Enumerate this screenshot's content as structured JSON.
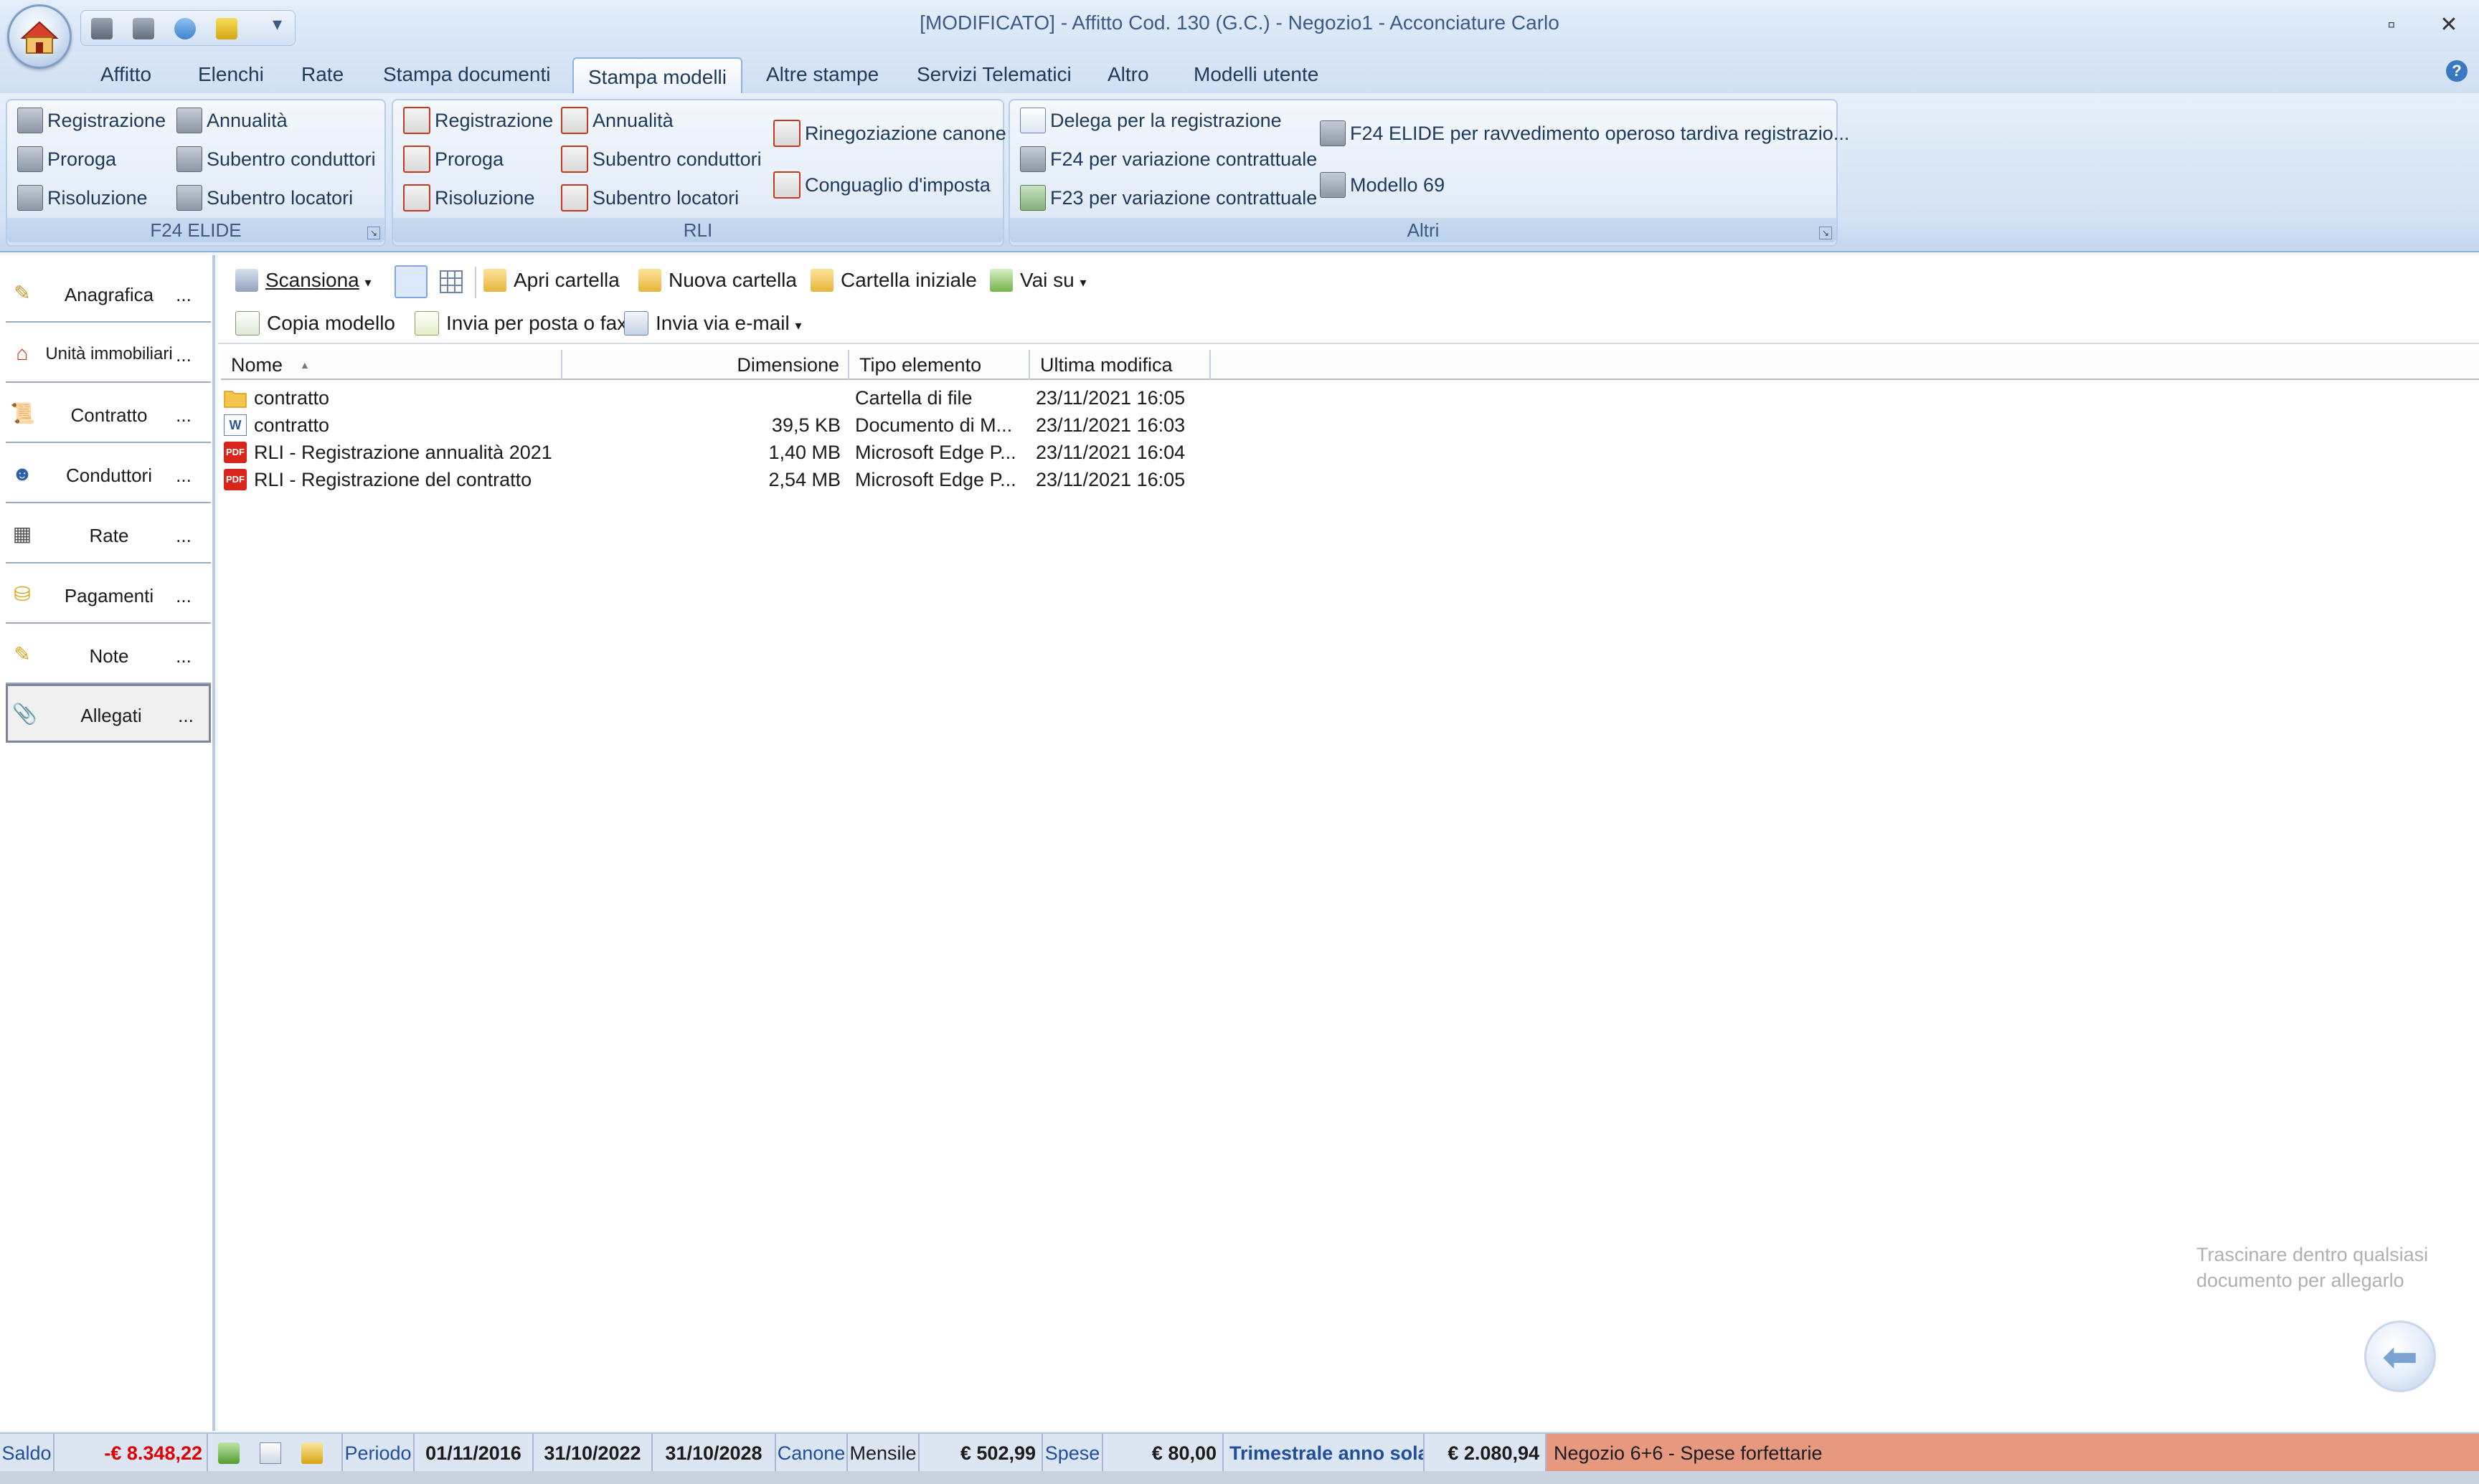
{
  "window": {
    "title": "[MODIFICATO] - Affitto Cod. 130 (G.C.) - Negozio1 - Acconciature Carlo",
    "qat_more": "▾",
    "restore_glyph": "▫",
    "close_glyph": "✕",
    "help_glyph": "?"
  },
  "tabs": [
    "Affitto",
    "Elenchi",
    "Rate",
    "Stampa documenti",
    "Stampa modelli",
    "Altre stampe",
    "Servizi Telematici",
    "Altro",
    "Modelli utente"
  ],
  "ribbon": {
    "f24": {
      "title": "F24 ELIDE",
      "items": [
        "Registrazione",
        "Proroga",
        "Risoluzione",
        "Annualità",
        "Subentro conduttori",
        "Subentro locatori"
      ]
    },
    "rli": {
      "title": "RLI",
      "items": [
        "Registrazione",
        "Proroga",
        "Risoluzione",
        "Annualità",
        "Subentro conduttori",
        "Subentro locatori",
        "Rinegoziazione canone",
        "Conguaglio d'imposta"
      ]
    },
    "altri": {
      "title": "Altri",
      "items": [
        "Delega per la registrazione",
        "F24 per variazione contrattuale",
        "F23 per variazione contrattuale",
        "F24 ELIDE per ravvedimento operoso tardiva registrazio...",
        "Modello 69"
      ]
    }
  },
  "nav": {
    "dots": "...",
    "items": [
      "Anagrafica",
      "Unità immobiliari",
      "Contratto",
      "Conduttori",
      "Rate",
      "Pagamenti",
      "Note",
      "Allegati"
    ]
  },
  "toolbar": {
    "scan": "Scansiona",
    "open_folder": "Apri cartella",
    "new_folder": "Nuova cartella",
    "initial_folder": "Cartella iniziale",
    "go_up": "Vai su",
    "copy_model": "Copia modello",
    "send_post_fax": "Invia per posta o fax",
    "send_email": "Invia via e-mail",
    "caret": "▾"
  },
  "files": {
    "columns": [
      "Nome",
      "Dimensione",
      "Tipo elemento",
      "Ultima modifica"
    ],
    "sort_glyph": "▲",
    "rows": [
      {
        "name": "contratto",
        "size": "",
        "type": "Cartella di file",
        "modified": "23/11/2021 16:05",
        "icon": "folder-icon"
      },
      {
        "name": "contratto",
        "size": "39,5 KB",
        "type": "Documento di M...",
        "modified": "23/11/2021 16:03",
        "icon": "word-doc-icon"
      },
      {
        "name": "RLI - Registrazione annualità 2021",
        "size": "1,40 MB",
        "type": "Microsoft Edge P...",
        "modified": "23/11/2021 16:04",
        "icon": "pdf-icon"
      },
      {
        "name": "RLI - Registrazione del contratto",
        "size": "2,54 MB",
        "type": "Microsoft Edge P...",
        "modified": "23/11/2021 16:05",
        "icon": "pdf-icon"
      }
    ],
    "pdf_badge": "PDF",
    "word_badge": "W"
  },
  "drop_hint": "Trascinare dentro qualsiasi documento per allegarlo",
  "status": {
    "saldo_label": "Saldo",
    "saldo_value": "-€ 8.348,22",
    "periodo_label": "Periodo",
    "date1": "01/11/2016",
    "date2": "31/10/2022",
    "date3": "31/10/2028",
    "canone_label": "Canone",
    "frequency": "Mensile",
    "canone_value": "€ 502,99",
    "spese_label": "Spese",
    "spese_value": "€ 80,00",
    "trimestrale": "Trimestrale anno sola",
    "total": "€ 2.080,94",
    "note": "Negozio 6+6 - Spese forfettarie"
  },
  "colors": {
    "accent": "#1e395b",
    "negative": "#e00000",
    "status_note_bg": "#e7997f",
    "blue_text": "#1f4e9c"
  }
}
